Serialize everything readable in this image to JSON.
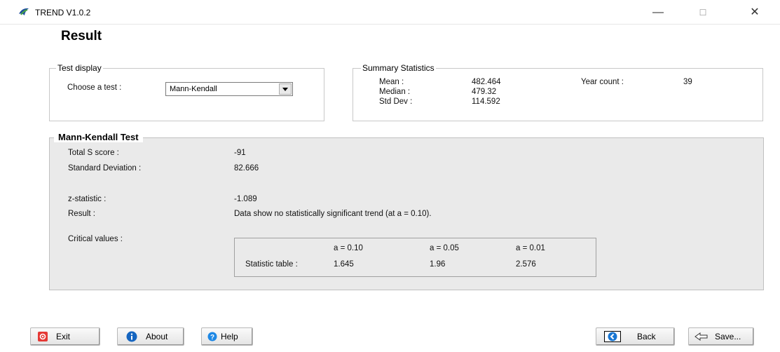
{
  "window": {
    "title": "TREND V1.0.2",
    "minimize": "—",
    "maximize": "☐",
    "close": "✕"
  },
  "page": {
    "title": "Result"
  },
  "test_display": {
    "legend": "Test display",
    "label": "Choose a test :",
    "selected": "Mann-Kendall"
  },
  "summary": {
    "legend": "Summary Statistics",
    "mean_label": "Mean :",
    "mean": "482.464",
    "median_label": "Median :",
    "median": "479.32",
    "std_label": "Std Dev :",
    "std": "114.592",
    "year_count_label": "Year count :",
    "year_count": "39"
  },
  "mk": {
    "legend": "Mann-Kendall Test",
    "s_label": "Total S score :",
    "s": "-91",
    "sd_label": "Standard Deviation :",
    "sd": "82.666",
    "z_label": "z-statistic :",
    "z": "-1.089",
    "result_label": "Result :",
    "result": "Data show no statistically significant trend (at a = 0.10).",
    "critical_label": "Critical values :"
  },
  "critical_table": {
    "headers": [
      "a = 0.10",
      "a = 0.05",
      "a = 0.01"
    ],
    "row_label": "Statistic table :",
    "values": [
      "1.645",
      "1.96",
      "2.576"
    ]
  },
  "buttons": {
    "exit": "Exit",
    "about": "About",
    "help": "Help",
    "back": "Back",
    "save": "Save..."
  },
  "colors": {
    "exit_red": "#e53935",
    "about_blue": "#1565c0",
    "help_blue": "#1e88e5",
    "back_blue": "#1976d2"
  }
}
